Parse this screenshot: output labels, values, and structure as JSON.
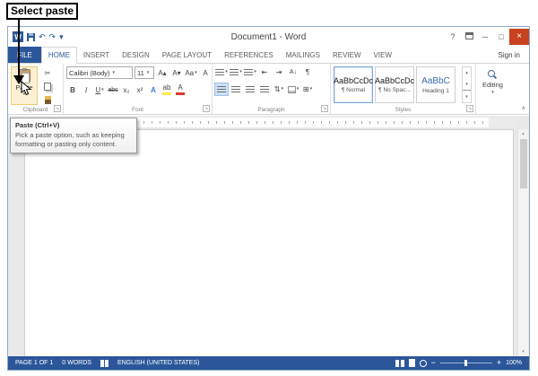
{
  "annotation": {
    "label": "Select paste"
  },
  "window": {
    "title": "Document1 - Word",
    "sign_in": "Sign in"
  },
  "tabs": {
    "file": "FILE",
    "active": "HOME",
    "items": [
      "HOME",
      "INSERT",
      "DESIGN",
      "PAGE LAYOUT",
      "REFERENCES",
      "MAILINGS",
      "REVIEW",
      "VIEW"
    ]
  },
  "ribbon": {
    "clipboard": {
      "label": "Clipboard",
      "paste": "Paste"
    },
    "font": {
      "label": "Font",
      "font_name": "Calibri (Body)",
      "font_size": "11",
      "bold": "B",
      "italic": "I",
      "underline": "U",
      "strikethrough": "abc",
      "subscript": "x₂",
      "superscript": "x²",
      "text_effects": "A",
      "highlight": "ab",
      "font_color": "A"
    },
    "paragraph": {
      "label": "Paragraph"
    },
    "styles": {
      "label": "Styles",
      "items": [
        {
          "preview": "AaBbCcDc",
          "name": "¶ Normal"
        },
        {
          "preview": "AaBbCcDc",
          "name": "¶ No Spac..."
        },
        {
          "preview": "AaBbC",
          "name": "Heading 1"
        }
      ]
    },
    "editing": {
      "label": "Editing"
    }
  },
  "tooltip": {
    "title": "Paste (Ctrl+V)",
    "description": "Pick a paste option, such as keeping formatting or pasting only content."
  },
  "statusbar": {
    "page": "PAGE 1 OF 1",
    "words": "0 WORDS",
    "language": "ENGLISH (UNITED STATES)",
    "zoom_level": "100%"
  },
  "icons": {
    "word_logo": "W",
    "help": "?",
    "minimize": "─",
    "maximize": "□",
    "close": "×",
    "undo": "↶",
    "redo": "↷",
    "dropdown": "▾",
    "cut": "✂",
    "launcher": "↘",
    "grow_font": "A▴",
    "shrink_font": "A▾",
    "change_case": "Aa",
    "clear_formatting": "A",
    "decrease_indent": "⇤",
    "increase_indent": "⇥",
    "sort": "A↓",
    "pilcrow": "¶",
    "line_spacing": "⇅",
    "borders": "⊞",
    "scroll_up": "▴",
    "scroll_down": "▾",
    "more_styles": "▾",
    "collapse_ribbon": "∧",
    "zoom_out": "−",
    "zoom_in": "+"
  },
  "colors": {
    "accent": "#2b579a",
    "paste_highlight": "#fcf1d4",
    "close_red": "#c8421f",
    "statusbar": "#2b579a"
  }
}
